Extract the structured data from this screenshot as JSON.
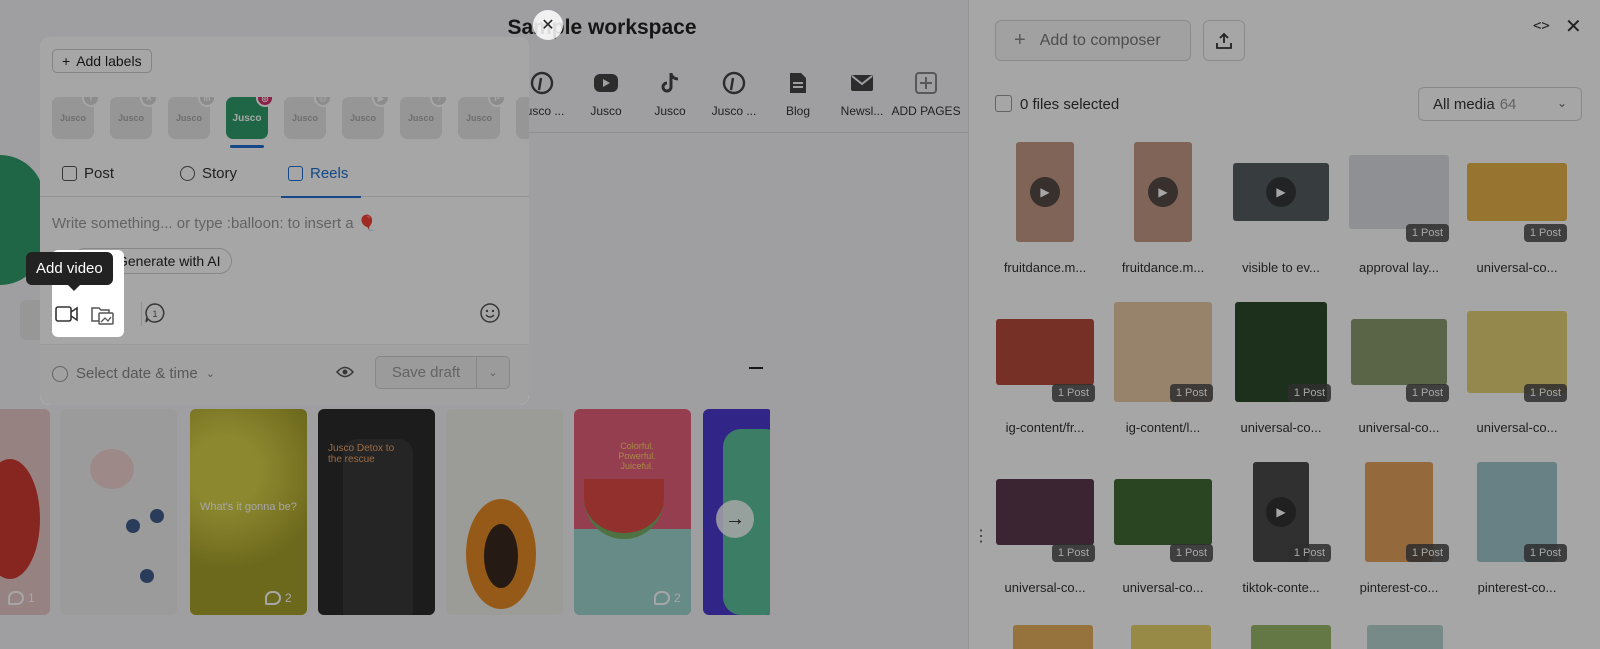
{
  "workspace": {
    "title": "Sample workspace",
    "pages": [
      {
        "label": "Jusco ...",
        "icon": "pinterest-icon"
      },
      {
        "label": "Jusco",
        "icon": "youtube-icon"
      },
      {
        "label": "Jusco",
        "icon": "tiktok-icon"
      },
      {
        "label": "Jusco ...",
        "icon": "pinterest-icon"
      },
      {
        "label": "Blog",
        "icon": "document-icon"
      },
      {
        "label": "Newsl...",
        "icon": "mail-icon"
      },
      {
        "label": "ADD PAGES",
        "icon": "plus-square-icon"
      }
    ],
    "carousel": [
      {
        "comments": "1",
        "overlay": ""
      },
      {
        "comments": "",
        "overlay": ""
      },
      {
        "comments": "2",
        "overlay": "What's it gonna be?"
      },
      {
        "comments": "",
        "overlay": "Jusco Detox to the rescue"
      },
      {
        "comments": "",
        "overlay": ""
      },
      {
        "comments": "2",
        "overlay": "Colorful. Powerful. Juiceful."
      },
      {
        "comments": "",
        "overlay": ""
      }
    ]
  },
  "composer": {
    "add_labels": "Add labels",
    "channels": [
      {
        "network": "facebook-icon",
        "name": "Jusco"
      },
      {
        "network": "x-icon",
        "name": "Jusco"
      },
      {
        "network": "linkedin-icon",
        "name": "Jusco"
      },
      {
        "network": "instagram-icon",
        "name": "Jusco",
        "active": true
      },
      {
        "network": "threads-icon",
        "name": "Jusco"
      },
      {
        "network": "youtube-icon",
        "name": "Jusco"
      },
      {
        "network": "tiktok-icon",
        "name": "Jusco"
      },
      {
        "network": "pinterest-icon",
        "name": "Jusco"
      }
    ],
    "tabs": {
      "post": "Post",
      "story": "Story",
      "reels": "Reels"
    },
    "placeholder": "Write something... or type :balloon: to insert a 🎈",
    "ai_button": "Generate with AI",
    "tooltip": "Add video",
    "date_select": "Select date & time",
    "save_draft": "Save draft"
  },
  "media_panel": {
    "add_to_composer": "Add to composer",
    "files_selected": "0 files selected",
    "filter_label": "All media",
    "filter_count": "64",
    "items": [
      {
        "name": "fruitdance.m...",
        "video": true,
        "badge": "",
        "color": "#c59a88"
      },
      {
        "name": "fruitdance.m...",
        "video": true,
        "badge": "",
        "color": "#c59a88"
      },
      {
        "name": "visible to ev...",
        "video": true,
        "badge": "",
        "color": "#555d60"
      },
      {
        "name": "approval lay...",
        "video": false,
        "badge": "1 Post",
        "color": "#dadde3"
      },
      {
        "name": "universal-co...",
        "video": false,
        "badge": "1 Post",
        "color": "#e8b24a"
      },
      {
        "name": "ig-content/fr...",
        "video": false,
        "badge": "1 Post",
        "color": "#b64b3b"
      },
      {
        "name": "ig-content/l...",
        "video": false,
        "badge": "1 Post",
        "color": "#e8c9a6"
      },
      {
        "name": "universal-co...",
        "video": false,
        "badge": "1 Post",
        "color": "#2d4a2a"
      },
      {
        "name": "universal-co...",
        "video": false,
        "badge": "1 Post",
        "color": "#8a9b6d"
      },
      {
        "name": "universal-co...",
        "video": false,
        "badge": "1 Post",
        "color": "#e5d277"
      },
      {
        "name": "universal-co...",
        "video": false,
        "badge": "1 Post",
        "color": "#5b3a4e"
      },
      {
        "name": "universal-co...",
        "video": false,
        "badge": "1 Post",
        "color": "#3f6a33"
      },
      {
        "name": "tiktok-conte...",
        "video": true,
        "badge": "1 Post",
        "color": "#4a4a4a"
      },
      {
        "name": "pinterest-co...",
        "video": false,
        "badge": "1 Post",
        "color": "#e3a25c"
      },
      {
        "name": "pinterest-co...",
        "video": false,
        "badge": "1 Post",
        "color": "#9fc7cc"
      }
    ]
  }
}
